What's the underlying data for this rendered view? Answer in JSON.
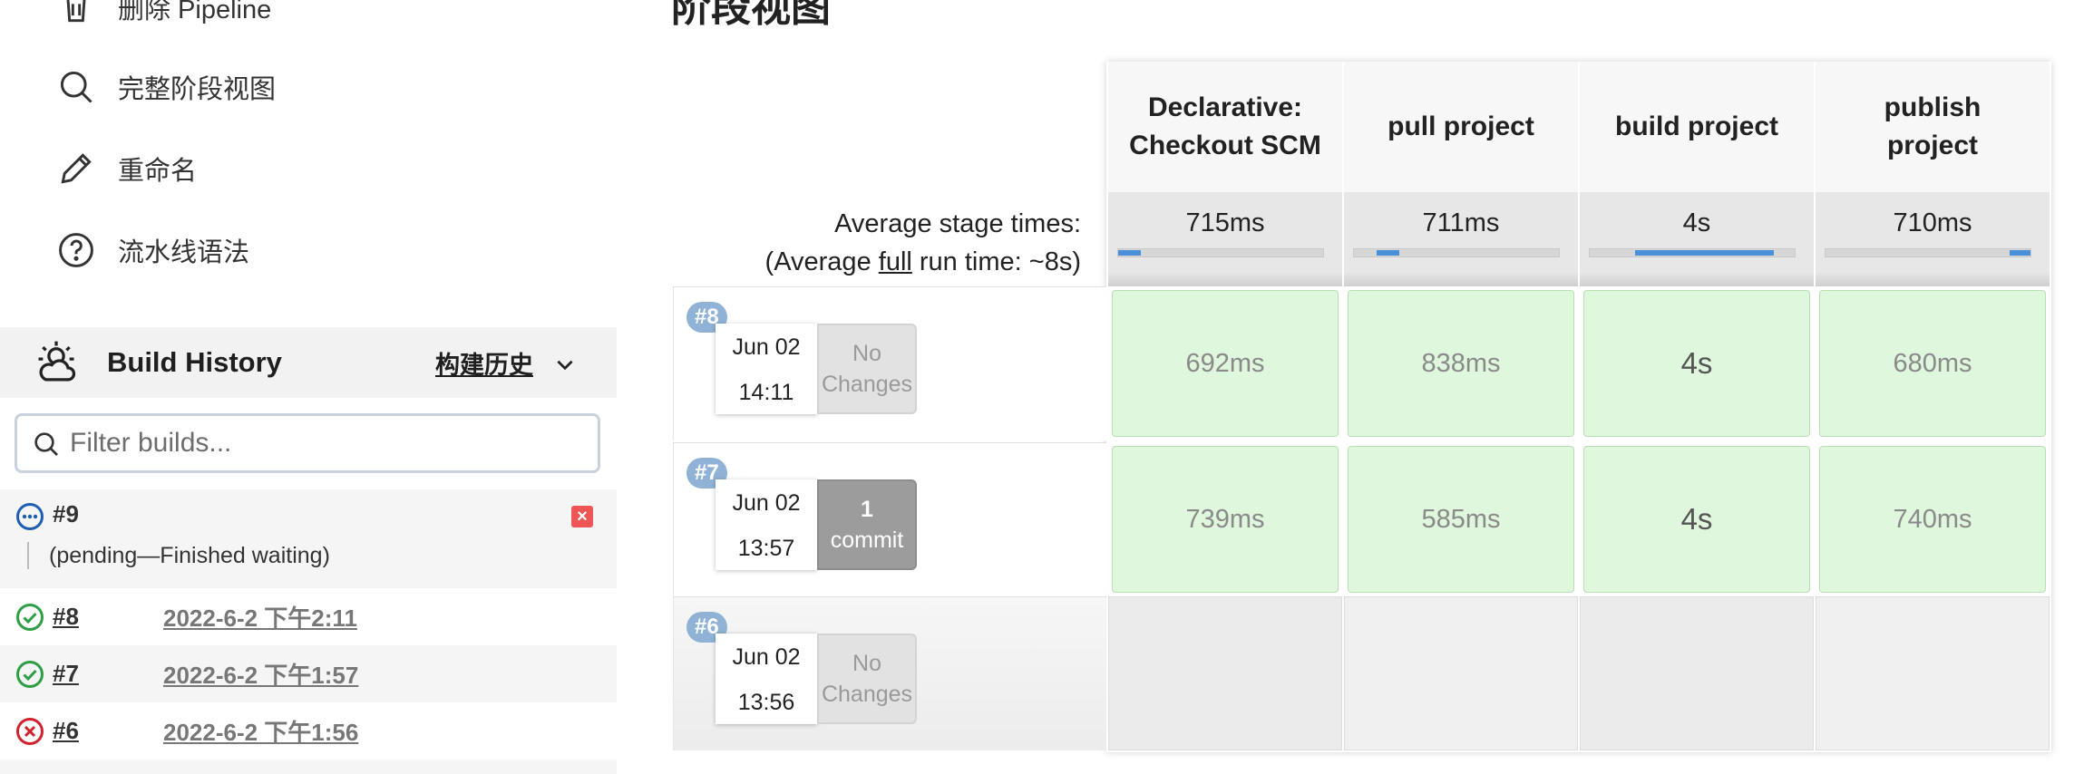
{
  "sidebar": {
    "tasks": [
      {
        "label": "删除 Pipeline",
        "icon": "trash-icon"
      },
      {
        "label": "完整阶段视图",
        "icon": "search-icon"
      },
      {
        "label": "重命名",
        "icon": "pencil-icon"
      },
      {
        "label": "流水线语法",
        "icon": "help-circle-icon"
      }
    ],
    "build_history": {
      "title": "Build History",
      "trend_label": "构建历史",
      "filter_placeholder": "Filter builds...",
      "pending": {
        "number": "#9",
        "text": "(pending—Finished waiting)"
      },
      "builds": [
        {
          "number": "#8",
          "date": "2022-6-2 下午2:11",
          "status": "success"
        },
        {
          "number": "#7",
          "date": "2022-6-2 下午1:57",
          "status": "success"
        },
        {
          "number": "#6",
          "date": "2022-6-2 下午1:56",
          "status": "failed"
        }
      ]
    }
  },
  "stage_view": {
    "heading": "阶段视图",
    "stages": [
      {
        "name_line1": "Declarative:",
        "name_line2": "Checkout SCM",
        "avg": "715ms",
        "bar_start": 0.0,
        "bar_share": 0.11
      },
      {
        "name_line1": "pull project",
        "name_line2": "",
        "avg": "711ms",
        "bar_start": 0.11,
        "bar_share": 0.11
      },
      {
        "name_line1": "build project",
        "name_line2": "",
        "avg": "4s",
        "bar_start": 0.22,
        "bar_share": 0.68
      },
      {
        "name_line1": "publish",
        "name_line2": "project",
        "avg": "710ms",
        "bar_start": 0.9,
        "bar_share": 0.1
      }
    ],
    "avg_label_line1": "Average stage times:",
    "avg_label_prefix": "(Average ",
    "avg_label_full": "full",
    "avg_label_suffix": " run time: ~8s)",
    "runs": [
      {
        "badge": "#8",
        "date": "Jun 02",
        "time": "14:11",
        "changes_line1": "No",
        "changes_line2": "Changes",
        "times": [
          "692ms",
          "838ms",
          "4s",
          "680ms"
        ]
      },
      {
        "badge": "#7",
        "date": "Jun 02",
        "time": "13:57",
        "changes_line1": "1",
        "changes_line2": "commit",
        "times": [
          "739ms",
          "585ms",
          "4s",
          "740ms"
        ]
      },
      {
        "badge": "#6",
        "date": "Jun 02",
        "time": "13:56",
        "changes_line1": "No",
        "changes_line2": "Changes",
        "times": [
          "",
          "",
          "",
          ""
        ]
      }
    ]
  },
  "colors": {
    "success": "#2e9e44",
    "failed": "#d2212f",
    "pending": "#1e5fb4",
    "stage_ok_bg": "#dff7dc",
    "avg_bar": "#4a90d9",
    "badge": "#8fb2d6"
  }
}
